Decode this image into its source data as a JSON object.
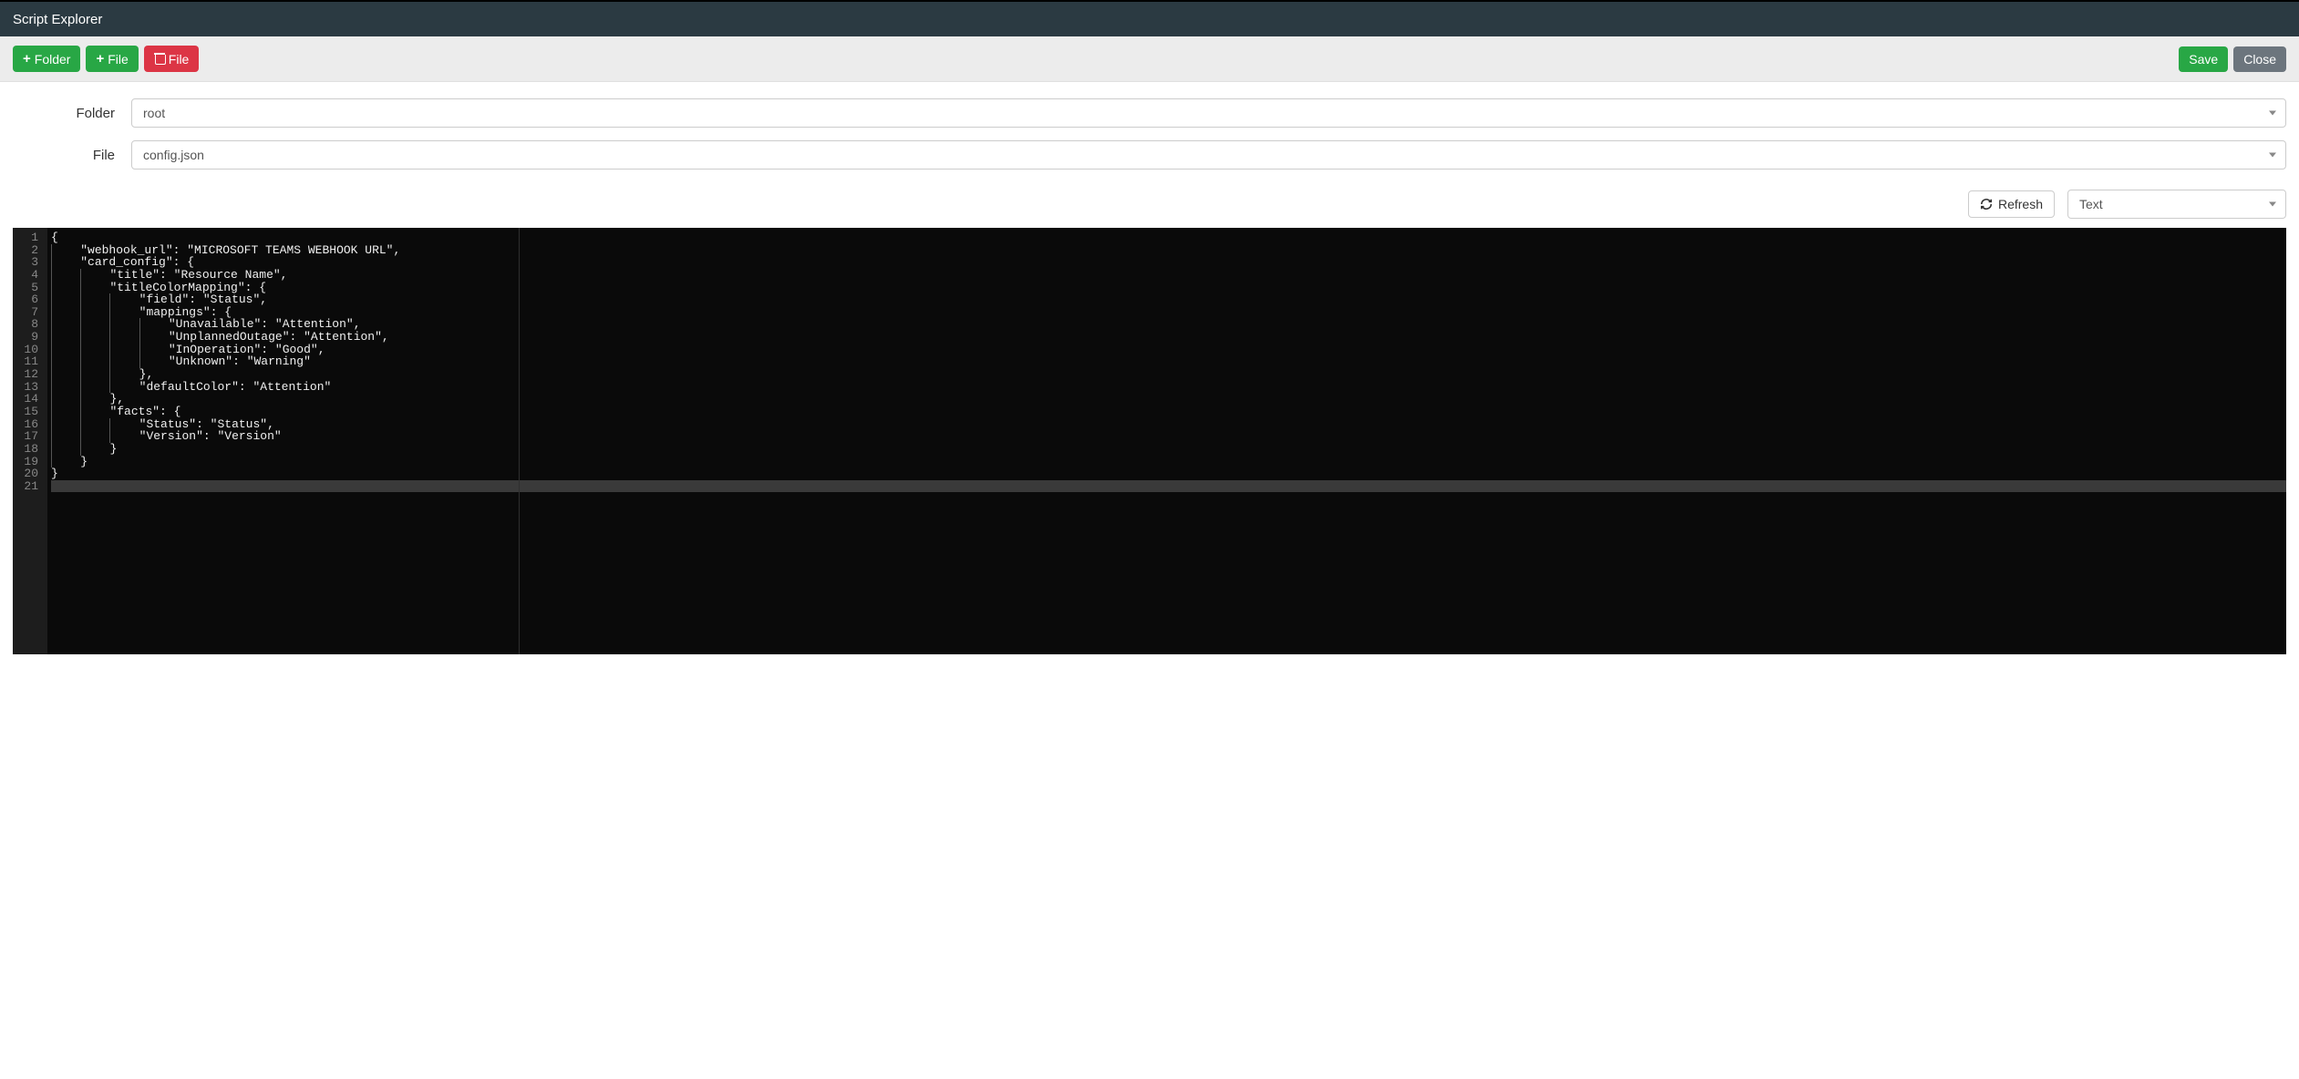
{
  "header": {
    "title": "Script Explorer"
  },
  "toolbar": {
    "add_folder": "Folder",
    "add_file": "File",
    "delete_file": "File",
    "save": "Save",
    "close": "Close"
  },
  "form": {
    "folder_label": "Folder",
    "folder_value": "root",
    "file_label": "File",
    "file_value": "config.json"
  },
  "actions": {
    "refresh": "Refresh",
    "mode": "Text"
  },
  "editor": {
    "line_count": 21,
    "active_line": 21,
    "lines": [
      "{",
      "    \"webhook_url\": \"MICROSOFT TEAMS WEBHOOK URL\",",
      "    \"card_config\": {",
      "        \"title\": \"Resource Name\",",
      "        \"titleColorMapping\": {",
      "            \"field\": \"Status\",",
      "            \"mappings\": {",
      "                \"Unavailable\": \"Attention\",",
      "                \"UnplannedOutage\": \"Attention\",",
      "                \"InOperation\": \"Good\",",
      "                \"Unknown\": \"Warning\"",
      "            },",
      "            \"defaultColor\": \"Attention\"",
      "        },",
      "        \"facts\": {",
      "            \"Status\": \"Status\",",
      "            \"Version\": \"Version\"",
      "        }",
      "    }",
      "}",
      ""
    ]
  }
}
